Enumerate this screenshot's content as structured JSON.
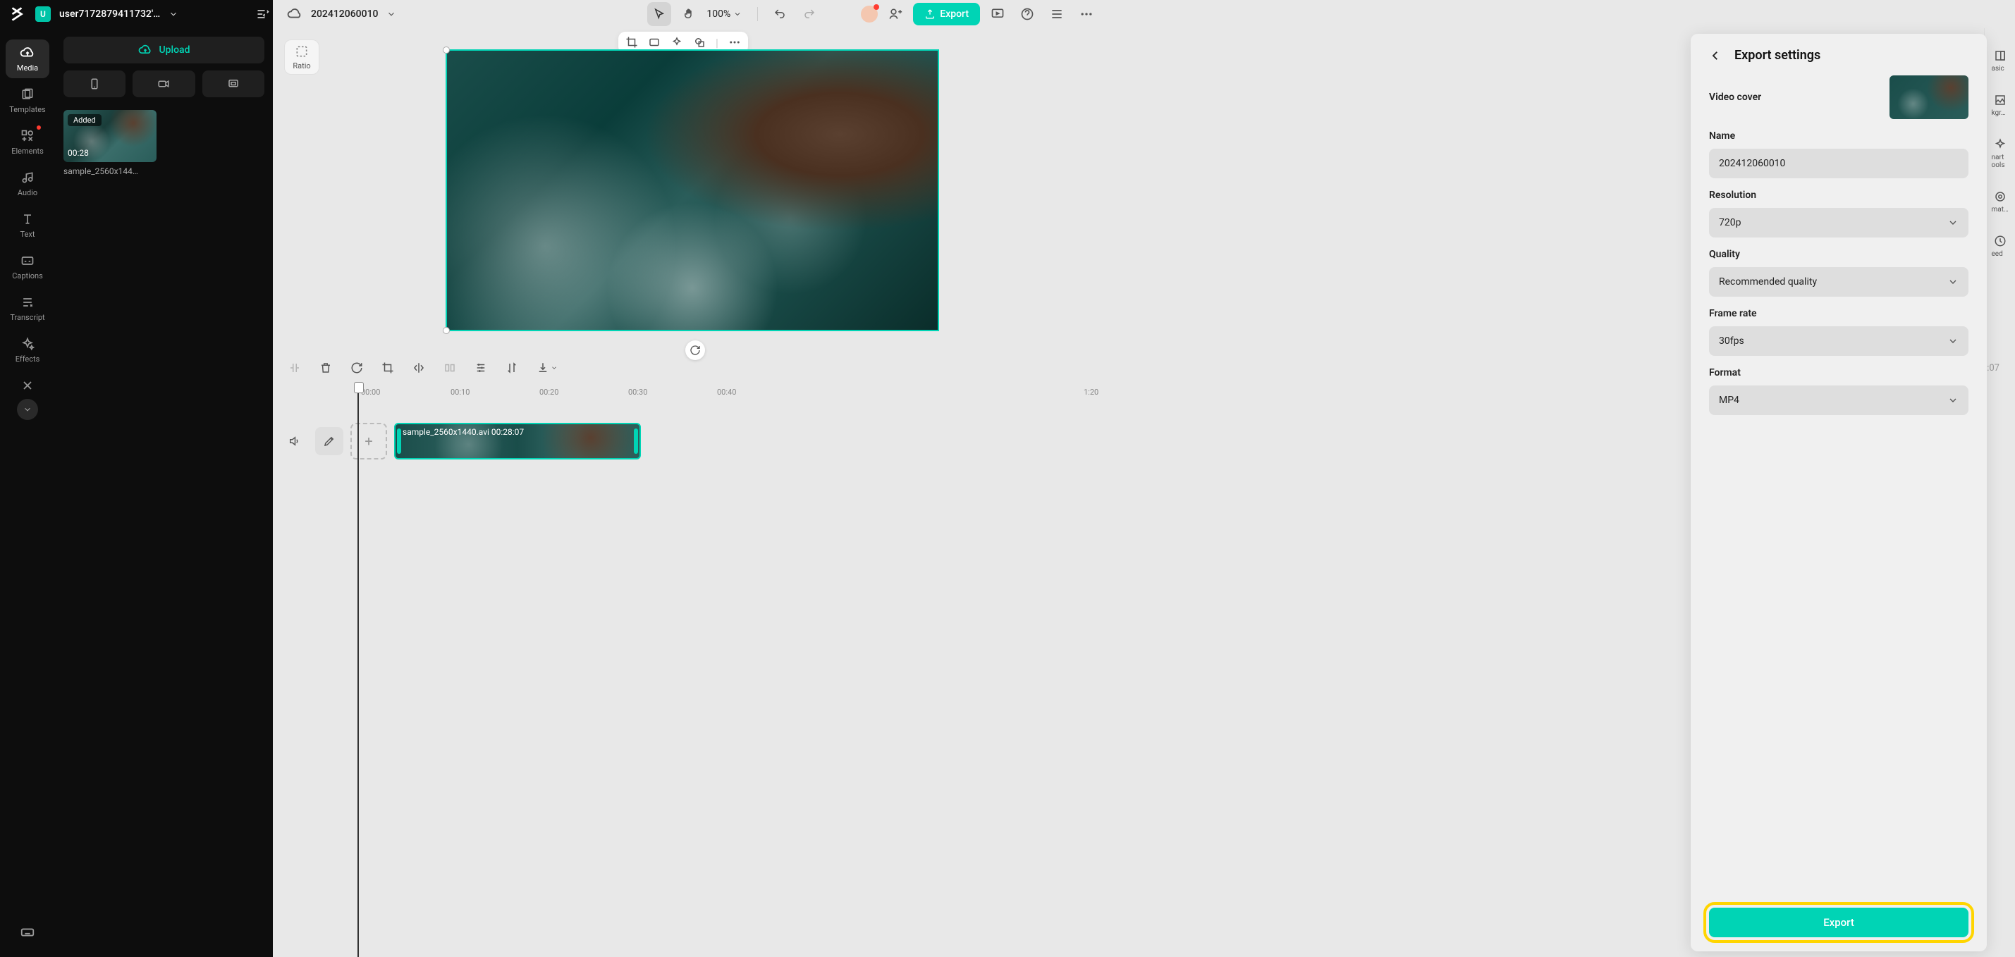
{
  "topbar": {
    "user_initial": "U",
    "username": "user7172879411732'…",
    "project_name": "202412060010",
    "zoom": "100%",
    "export_label": "Export"
  },
  "rail": {
    "items": [
      {
        "label": "Media"
      },
      {
        "label": "Templates"
      },
      {
        "label": "Elements"
      },
      {
        "label": "Audio"
      },
      {
        "label": "Text"
      },
      {
        "label": "Captions"
      },
      {
        "label": "Transcript"
      },
      {
        "label": "Effects"
      }
    ]
  },
  "media": {
    "upload_label": "Upload",
    "thumb_added": "Added",
    "thumb_duration": "00:28",
    "thumb_name": "sample_2560x144…"
  },
  "canvas": {
    "ratio_label": "Ratio"
  },
  "right_rail": {
    "items": [
      {
        "label": "asic"
      },
      {
        "label": "kgr…"
      },
      {
        "label": "nart\nools"
      },
      {
        "label": "mat…"
      },
      {
        "label": "eed"
      }
    ]
  },
  "timeline": {
    "current": "00:00:00",
    "duration": "00:28:07",
    "ticks": [
      "00:00",
      "00:10",
      "00:20",
      "00:30",
      "00:40",
      "1:20"
    ],
    "clip_label": "sample_2560x1440.avi    00:28:07"
  },
  "export": {
    "title": "Export settings",
    "cover_label": "Video cover",
    "name_label": "Name",
    "name_value": "202412060010",
    "resolution_label": "Resolution",
    "resolution_value": "720p",
    "quality_label": "Quality",
    "quality_value": "Recommended quality",
    "framerate_label": "Frame rate",
    "framerate_value": "30fps",
    "format_label": "Format",
    "format_value": "MP4",
    "button_label": "Export"
  }
}
